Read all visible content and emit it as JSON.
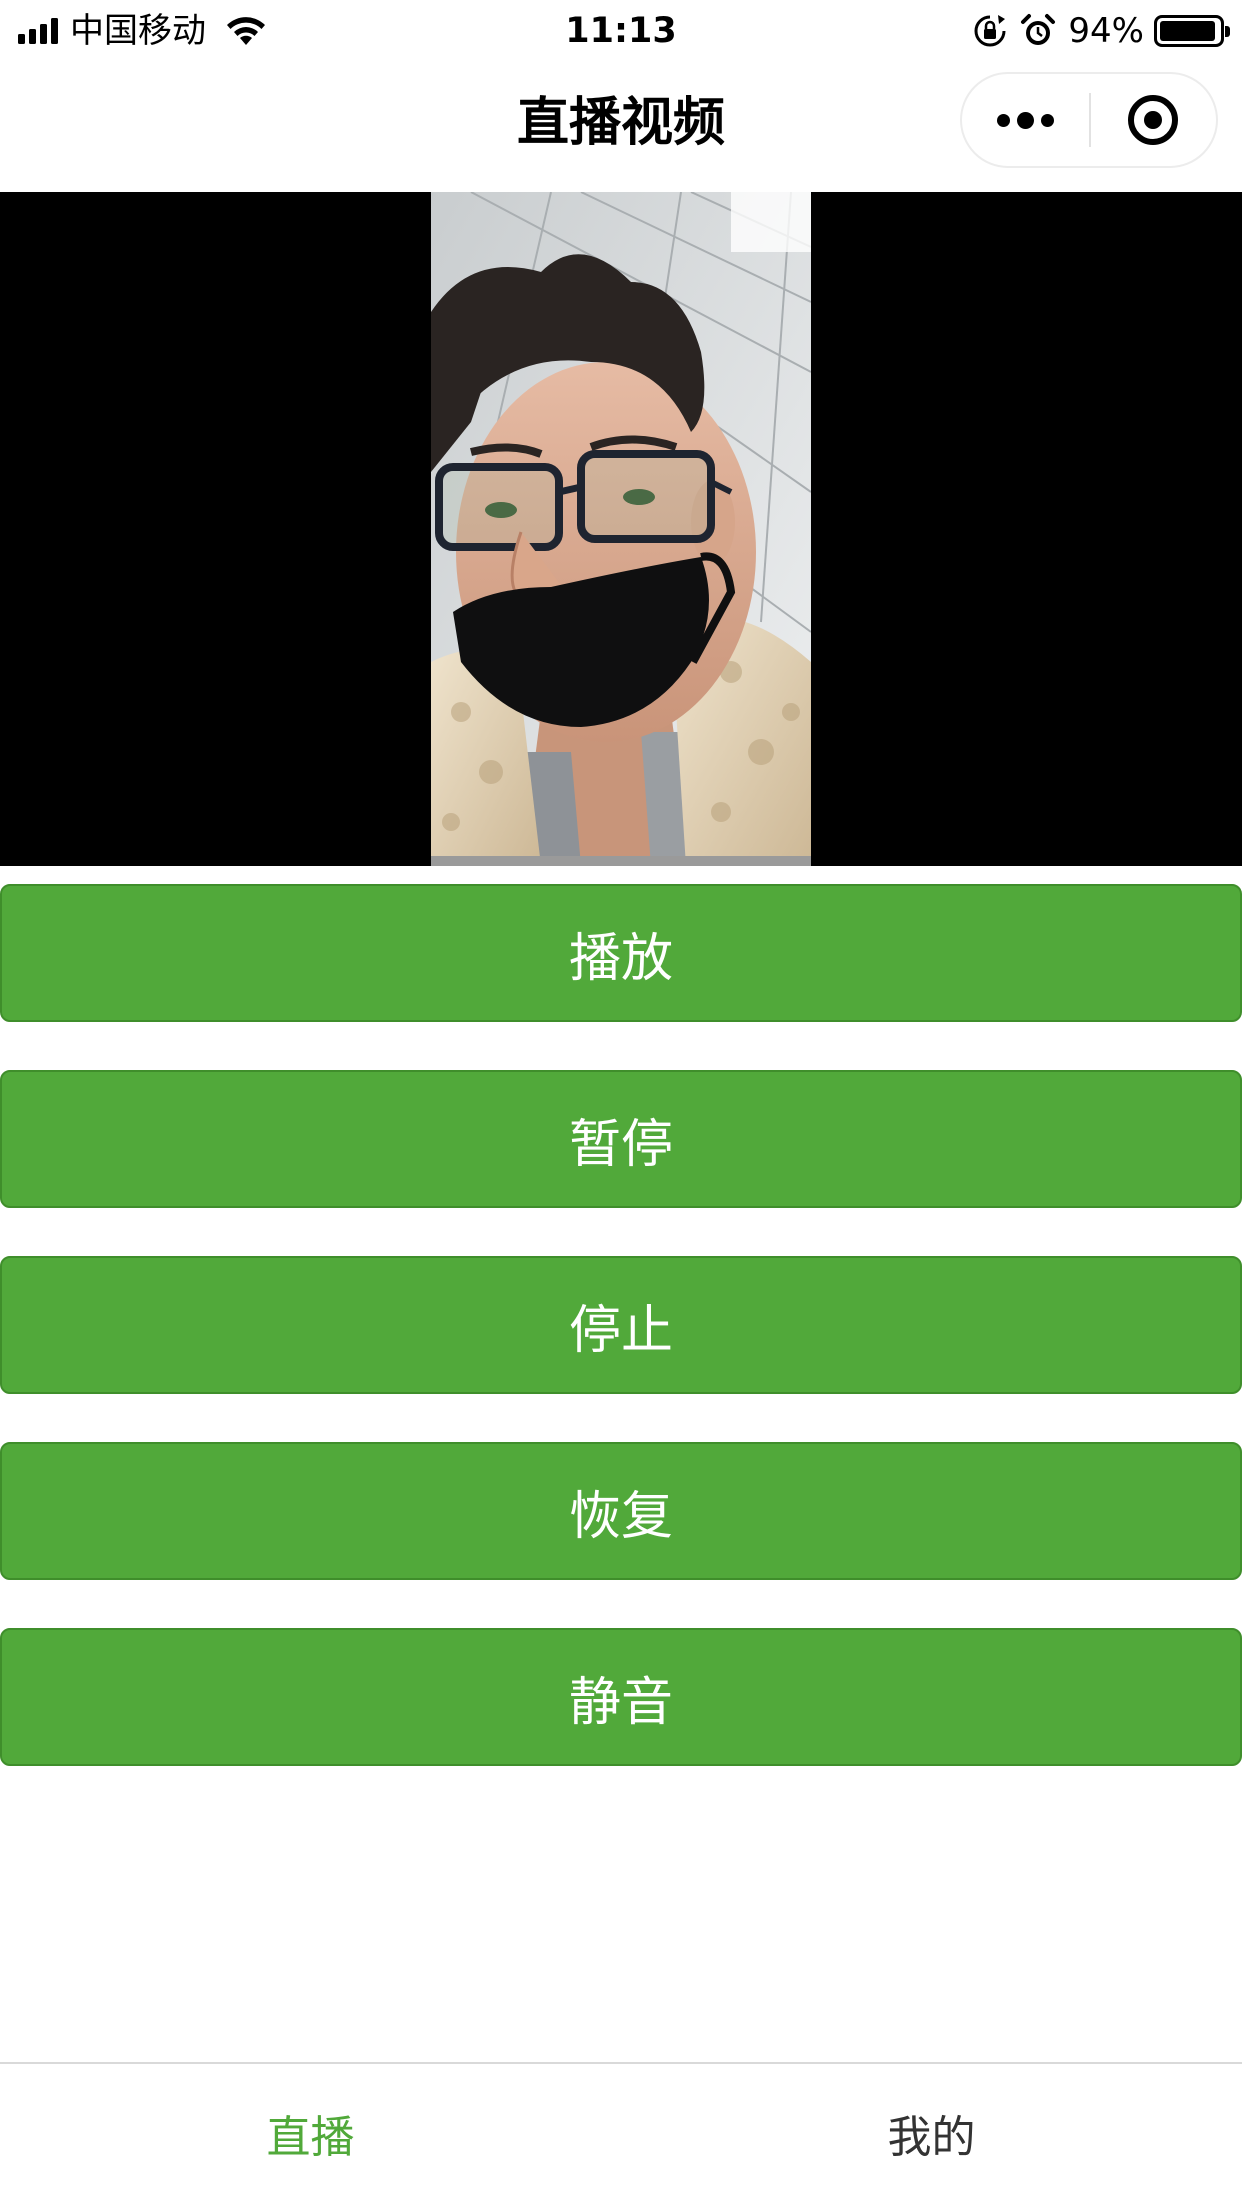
{
  "status_bar": {
    "carrier": "中国移动",
    "time": "11:13",
    "battery_percent": "94%",
    "battery_level": 0.94,
    "icons": [
      "signal-icon",
      "wifi-icon",
      "orientation-lock-icon",
      "alarm-icon",
      "battery-icon"
    ]
  },
  "nav_bar": {
    "title": "直播视频",
    "capsule": {
      "more_icon": "more-dots-icon",
      "close_icon": "target-close-icon"
    }
  },
  "video": {
    "content": "live camera preview: person with glasses and black face mask, beige fleece jacket"
  },
  "buttons": [
    {
      "label": "播放"
    },
    {
      "label": "暂停"
    },
    {
      "label": "停止"
    },
    {
      "label": "恢复"
    },
    {
      "label": "静音"
    }
  ],
  "tab_bar": {
    "tabs": [
      {
        "label": "直播",
        "active": true
      },
      {
        "label": "我的",
        "active": false
      }
    ],
    "active_color": "#51a93a",
    "inactive_color": "#333333"
  },
  "colors": {
    "button_green": "#51a93a",
    "button_border": "#3f8e2b"
  }
}
